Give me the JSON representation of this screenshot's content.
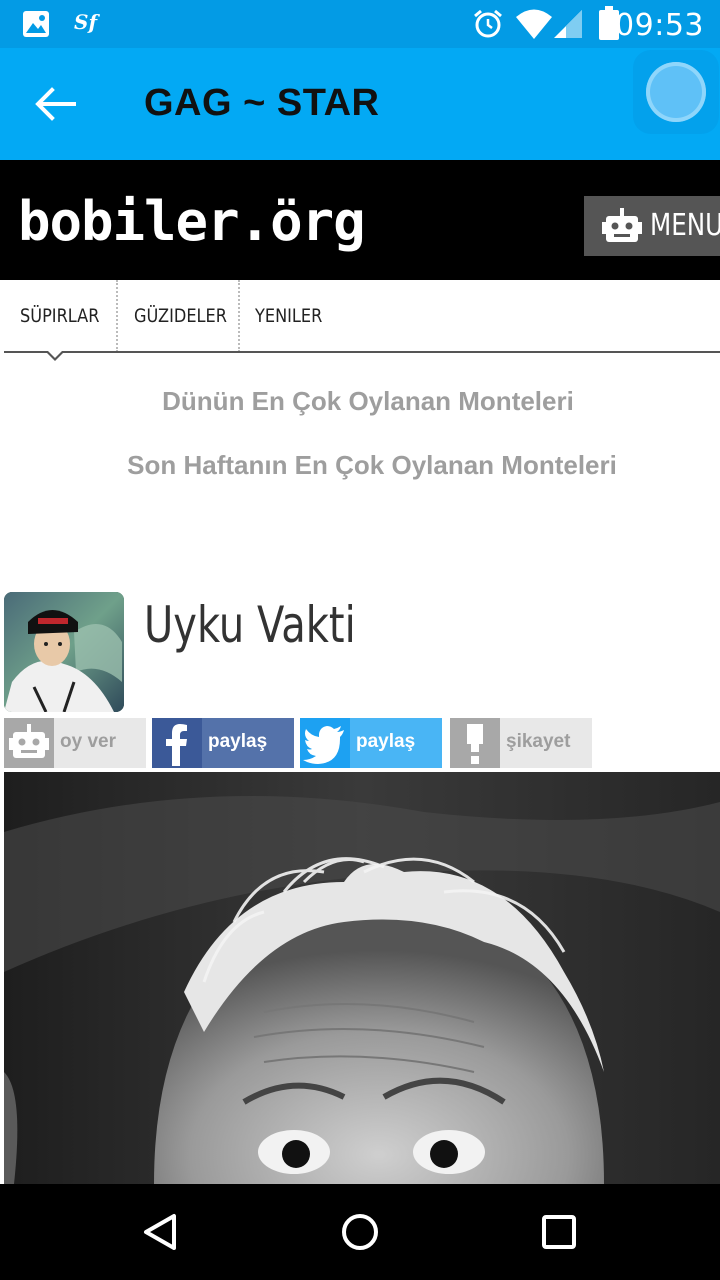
{
  "status_bar": {
    "time": "09:53",
    "left_icons": [
      "image-icon",
      "sf-icon"
    ],
    "sf_label": "Sf",
    "right_icons": [
      "alarm-icon",
      "wifi-icon",
      "signal-icon",
      "battery-icon"
    ]
  },
  "app_bar": {
    "title": "GAG ~ STAR",
    "back_icon": "arrow-left-icon",
    "color": "#03a9f4"
  },
  "site_header": {
    "logo_text": "bobiler.örg",
    "menu_label": "MENU",
    "menu_icon": "robot-icon"
  },
  "tabs": [
    {
      "label": "SÜPIRLAR",
      "active": true
    },
    {
      "label": "GÜZIDELER",
      "active": false
    },
    {
      "label": "YENILER",
      "active": false
    }
  ],
  "links": [
    "Dünün En Çok Oylanan Monteleri",
    "Son Haftanın En Çok Oylanan Monteleri"
  ],
  "post": {
    "title": "Uyku Vakti",
    "actions": {
      "vote": {
        "label": "oy ver",
        "icon": "robot-icon",
        "color": "#e8e8e8"
      },
      "facebook": {
        "label": "paylaş",
        "icon": "facebook-icon",
        "color": "#3b5998"
      },
      "twitter": {
        "label": "paylaş",
        "icon": "twitter-icon",
        "color": "#1da1f2"
      },
      "report": {
        "label": "şikayet",
        "icon": "exclamation-icon",
        "color": "#e8e8e8"
      }
    }
  },
  "nav_bar": {
    "icons": [
      "back-triangle-icon",
      "home-circle-icon",
      "recents-square-icon"
    ]
  }
}
